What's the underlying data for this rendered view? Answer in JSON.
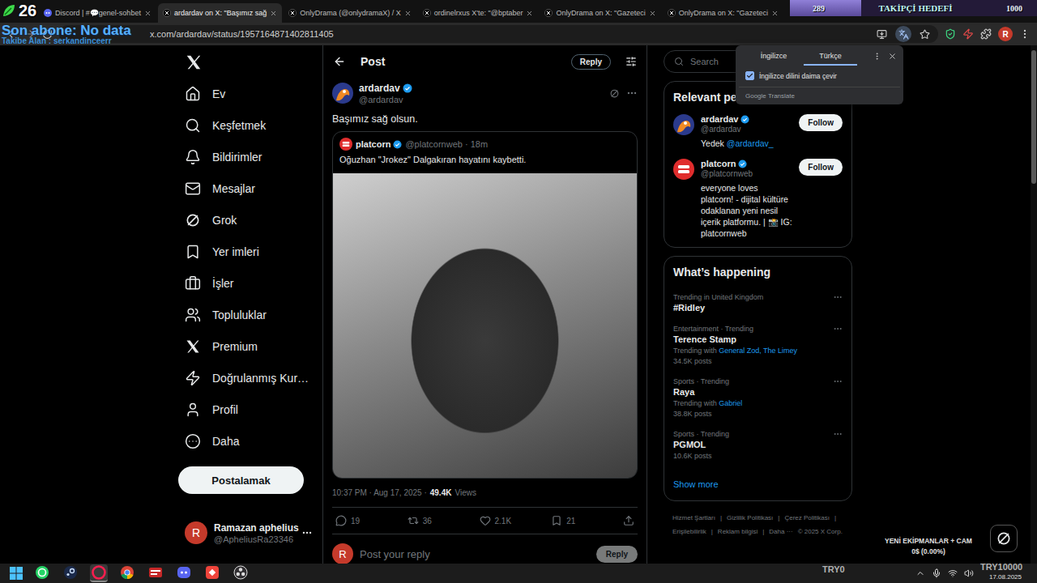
{
  "overlay": {
    "sub_counter": "26",
    "last_sub": "Son abone: No data",
    "follower": "Takibe Alan : serkandinceerr",
    "goal": {
      "title": "TAKİPÇİ HEDEFİ",
      "current": "289",
      "target": "1000",
      "level": 0.289
    },
    "equipment": {
      "title": "YENİ EKİPMANLAR + CAM",
      "amount": "0$ (0.00%)"
    },
    "try_left": "TRY0",
    "try_right": "TRY10000"
  },
  "browser": {
    "tabs": [
      {
        "label": "Discord | #💬genel-sohbet",
        "selected": false
      },
      {
        "label": "ardardav on X: \"Başımız sağ",
        "selected": true
      },
      {
        "label": "OnlyDrama (@onlydramaX) / X",
        "selected": false
      },
      {
        "label": "ordinelrxus X'te: \"@bptaber",
        "selected": false
      },
      {
        "label": "OnlyDrama on X: \"Gazeteci",
        "selected": false
      },
      {
        "label": "OnlyDrama on X: \"Gazeteci",
        "selected": false
      }
    ],
    "url": "x.com/ardardav/status/1957164871402811405",
    "profile_letter": "R"
  },
  "translate_popup": {
    "tabs": [
      {
        "label": "İngilizce",
        "selected": false
      },
      {
        "label": "Türkçe",
        "selected": true
      }
    ],
    "option": {
      "label": "İngilizce dilini daima çevir",
      "checked": true
    },
    "footer": "Google Translate"
  },
  "sidebar": {
    "items": [
      {
        "label": "Ev"
      },
      {
        "label": "Keşfetmek"
      },
      {
        "label": "Bildirimler"
      },
      {
        "label": "Mesajlar"
      },
      {
        "label": "Grok"
      },
      {
        "label": "Yer imleri"
      },
      {
        "label": "İşler"
      },
      {
        "label": "Topluluklar"
      },
      {
        "label": "Premium"
      },
      {
        "label": "Doğrulanmış Kur…"
      },
      {
        "label": "Profil"
      },
      {
        "label": "Daha"
      }
    ],
    "post_button": "Postalamak"
  },
  "account": {
    "avatar_letter": "R",
    "name": "Ramazan aphelius",
    "handle": "@ApheliusRa23346"
  },
  "header": {
    "title": "Post",
    "reply_button": "Reply"
  },
  "tweet": {
    "name": "ardardav",
    "handle": "@ardardav",
    "text": "Başımız sağ olsun.",
    "quote": {
      "name": "platcorn",
      "handle": "@platcornweb · 18m",
      "text": "Oğuzhan \"Jrokez\" Dalgakıran hayatını kaybetti."
    },
    "time": "10:37 PM · Aug 17, 2025 ·",
    "views": "49.4K",
    "views_label": "Views",
    "stats": {
      "replies": "19",
      "reposts": "36",
      "likes": "2.1K",
      "bookmarks": "21"
    }
  },
  "reply_box": {
    "avatar_letter": "R",
    "placeholder": "Post your reply",
    "button": "Reply"
  },
  "search": {
    "placeholder": "Search"
  },
  "relevant_people": {
    "title": "Relevant peo",
    "people": [
      {
        "name": "ardardav",
        "handle": "@ardardav",
        "bio_parts": [
          {
            "text": "Yedek",
            "link": false
          },
          {
            "text": "@ardardav_",
            "link": true
          }
        ],
        "button": "Follow"
      },
      {
        "name": "platcorn",
        "handle": "@platcornweb",
        "bio_parts": [
          {
            "text": "everyone loves platcorn! - dijital kültüre odaklanan yeni nesil içerik platformu. | 📸 IG: platcornweb",
            "link": false
          }
        ],
        "button": "Follow"
      }
    ]
  },
  "trends": {
    "title": "What’s happening",
    "items": [
      {
        "context": "Trending in United Kingdom",
        "name": "#Ridley"
      },
      {
        "context": "Entertainment · Trending",
        "name": "Terence Stamp",
        "related_label": "Trending with",
        "related": "General Zod, The Limey",
        "posts": "34.5K posts"
      },
      {
        "context": "Sports · Trending",
        "name": "Raya",
        "related_label": "Trending with",
        "related": "Gabriel",
        "posts": "38.8K posts"
      },
      {
        "context": "Sports · Trending",
        "name": "PGMOL",
        "posts": "10.6K posts"
      }
    ],
    "show_more": "Show more"
  },
  "footer": {
    "links": [
      "Hizmet Şartları",
      "Gizlilik Politikası",
      "Çerez Politikası",
      "Erişilebilirlik",
      "Reklam bilgisi",
      "Daha ···",
      "© 2025 X Corp."
    ],
    "separator": "|"
  },
  "taskbar": {
    "apps": [
      {
        "selected": false
      },
      {
        "selected": false
      },
      {
        "selected": true
      },
      {
        "selected": false
      },
      {
        "selected": false
      },
      {
        "selected": false
      },
      {
        "selected": false
      },
      {
        "selected": false
      }
    ],
    "date": "17.08.2025"
  }
}
